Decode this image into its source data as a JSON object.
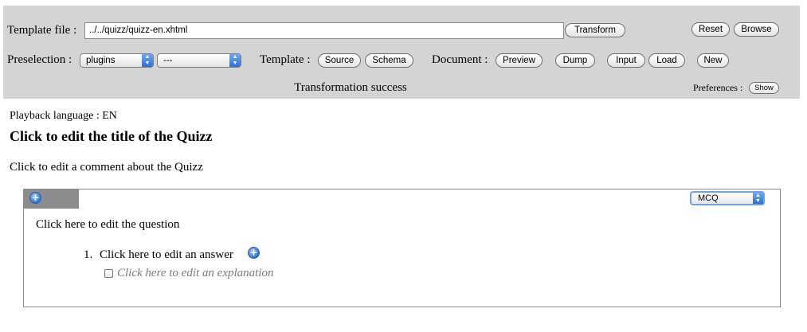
{
  "toolbar": {
    "template_file_label": "Template file :",
    "template_file_value": "../../quizz/quizz-en.xhtml",
    "transform_label": "Transform",
    "reset_label": "Reset",
    "browse_label": "Browse",
    "preselection_label": "Preselection :",
    "preselection_select_1": "plugins",
    "preselection_select_2": "---",
    "template_label": "Template :",
    "source_label": "Source",
    "schema_label": "Schema",
    "document_label": "Document :",
    "preview_label": "Preview",
    "dump_label": "Dump",
    "input_label": "Input",
    "load_label": "Load",
    "new_label": "New",
    "status_text": "Transformation success",
    "preferences_label": "Preferences :",
    "show_label": "Show"
  },
  "document": {
    "playback_language": "Playback language : EN",
    "title": "Click to edit the title of the Quizz",
    "comment": "Click to edit a comment about the Quizz",
    "question": {
      "type_value": "MCQ",
      "text": "Click here to edit the question",
      "answers": [
        {
          "number": "1.",
          "text": "Click here to edit an answer",
          "explanation": "Click here to edit an explanation"
        }
      ]
    }
  },
  "icons": {
    "add": "plus-circle-icon",
    "select_arrow": "updown-arrows-icon"
  },
  "colors": {
    "toolbar_bg": "#d4d4d4",
    "question_header_bg": "#8c8c8c",
    "accent_blue": "#2f74d8",
    "explanation_text": "#7a7a7a"
  }
}
